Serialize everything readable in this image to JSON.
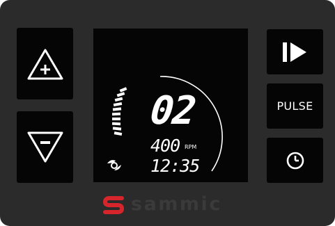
{
  "controls": {
    "pulse_label": "PULSE"
  },
  "display": {
    "speed_level": "02",
    "rpm_value": "400",
    "rpm_unit": "RPM",
    "time": "12:35"
  },
  "brand": {
    "name": "sammic",
    "accent_color": "#d6262b"
  },
  "icons": {
    "increase": "triangle-up-plus-icon",
    "decrease": "triangle-down-minus-icon",
    "start": "play-pause-icon",
    "timer": "clock-icon",
    "rotation": "rotation-direction-icon"
  },
  "colors": {
    "panel": "#2b2b2b",
    "button": "#050505",
    "display_text": "#ffffff",
    "logo_text": "#3a3a3a"
  }
}
